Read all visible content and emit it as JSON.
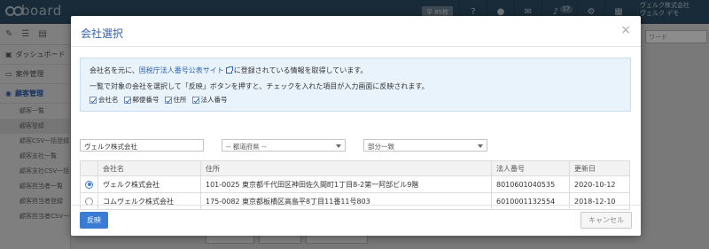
{
  "app": {
    "logo_text": "board",
    "user_badge": "平 85枚",
    "notification_count": "17",
    "company": "ヴェルク株式会社",
    "user_name": "ヴェルク デモ",
    "search_placeholder": "ワード"
  },
  "sidebar": {
    "items": [
      {
        "label": "ダッシュボード"
      },
      {
        "label": "案件管理"
      },
      {
        "label": "顧客管理"
      }
    ],
    "sub_items": [
      {
        "label": "顧客一覧"
      },
      {
        "label": "顧客登録"
      },
      {
        "label": "顧客CSV一括登録"
      },
      {
        "label": "顧客支社一覧"
      },
      {
        "label": "顧客支社CSV一括"
      },
      {
        "label": "顧客担当者一覧"
      },
      {
        "label": "顧客担当者登録"
      },
      {
        "label": "顧客担当者CSV一括"
      }
    ]
  },
  "modal": {
    "title": "会社選択",
    "close": "×",
    "info": {
      "prefix": "会社名を元に、",
      "link": "国税庁法人番号公表サイト",
      "suffix": "に登録されている情報を取得しています。",
      "line2": "一覧で対象の会社を選択して「反映」ボタンを押すと、チェックを入れた項目が入力画面に反映されます。",
      "checks": [
        {
          "label": "会社名"
        },
        {
          "label": "郵便番号"
        },
        {
          "label": "住所"
        },
        {
          "label": "法人番号"
        }
      ]
    },
    "filters": {
      "company_value": "ヴェルク株式会社",
      "prefecture_value": "-- 都道府県 --",
      "match_value": "部分一致"
    },
    "table": {
      "headers": [
        "",
        "会社名",
        "住所",
        "法人番号",
        "更新日"
      ],
      "rows": [
        {
          "selected": true,
          "name": "ヴェルク株式会社",
          "address": "101-0025 東京都千代田区神田佐久間町1丁目8-2第一阿部ビル9階",
          "number": "8010601040535",
          "date": "2020-10-12"
        },
        {
          "selected": false,
          "name": "コムヴェルク株式会社",
          "address": "175-0082 東京都板橋区高島平8丁目11番11号803",
          "number": "6010001132554",
          "date": "2018-12-10"
        }
      ]
    },
    "footer": {
      "apply_label": "反映",
      "cancel_label": "キャンセル"
    }
  }
}
